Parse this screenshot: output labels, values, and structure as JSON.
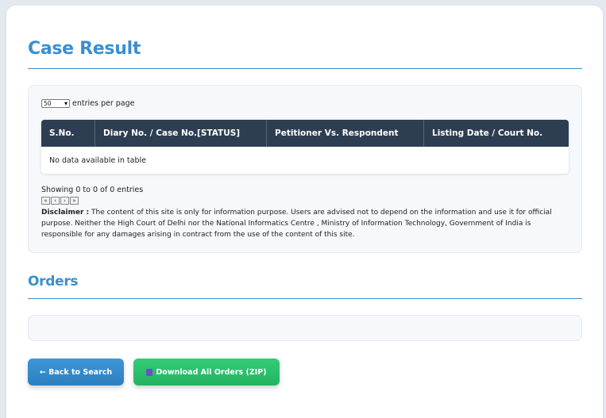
{
  "case_result": {
    "title": "Case Result",
    "entries": {
      "selected": "50",
      "label": "entries per page"
    },
    "table": {
      "columns": [
        "S.No.",
        "Diary No. / Case No.[STATUS]",
        "Petitioner Vs. Respondent",
        "Listing Date / Court No."
      ],
      "empty_message": "No data available in table"
    },
    "showing": "Showing 0 to 0 of 0 entries",
    "pager": [
      "«",
      "‹",
      "›",
      "»"
    ],
    "disclaimer": {
      "label": "Disclaimer :",
      "text": "The content of this site is only for information purpose. Users are advised not to depend on the information and use it for official purpose. Neither the High Court of Delhi nor the National Informatics Centre , Ministry of Information Technology, Government of India is responsible for any damages arising in contract from the use of the content of this site."
    }
  },
  "orders": {
    "title": "Orders"
  },
  "buttons": {
    "back": "← Back to Search",
    "download": "Download All Orders (ZIP)",
    "download_icon": "package-icon"
  },
  "colors": {
    "accent": "#3a8fd0",
    "table_header": "#2e3e52",
    "back_button": "#3d96d8",
    "download_button": "#2ec26d"
  }
}
